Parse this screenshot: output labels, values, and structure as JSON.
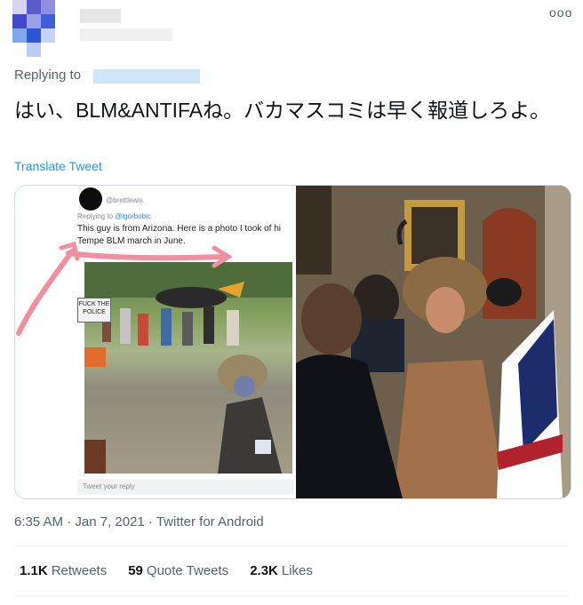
{
  "colors": {
    "link": "#1d9bf0",
    "muted": "#536471",
    "text": "#0f1419",
    "border": "#cfd9de"
  },
  "tweet": {
    "replying_label": "Replying to",
    "text": "はい、BLM&ANTIFAね。バカマスコミは早く報道しろよ。",
    "translate_label": "Translate Tweet",
    "meta": "6:35 AM · Jan 7, 2021 · Twitter for Android"
  },
  "embedded_tweet": {
    "handle": "@brettlewis",
    "replying_label": "Replying to",
    "replying_to": "@igorbobic",
    "text": "This guy is from Arizona. Here is a photo I took of hi Tempe BLM march in June.",
    "sign_text": "FUCK THE POLICE",
    "reply_placeholder": "Tweet your reply"
  },
  "stats": [
    {
      "count": "1.1K",
      "label": "Retweets"
    },
    {
      "count": "59",
      "label": "Quote Tweets"
    },
    {
      "count": "2.3K",
      "label": "Likes"
    }
  ],
  "icons": {
    "more": "more-horizontal-icon",
    "arrow": "pink-arrow-annotation"
  }
}
